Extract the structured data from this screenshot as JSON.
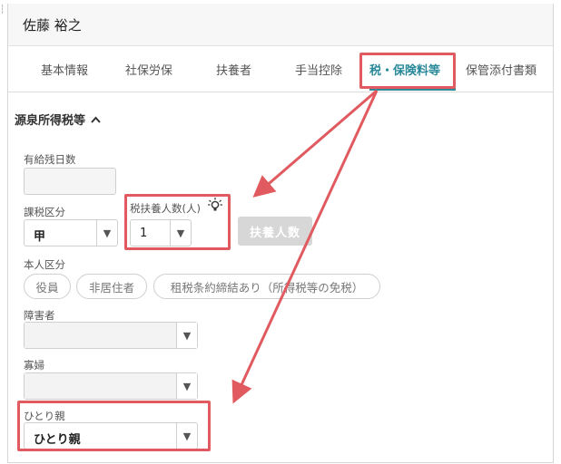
{
  "header": {
    "employee_name": "佐藤 裕之"
  },
  "tabs": [
    {
      "label": "基本情報",
      "active": false
    },
    {
      "label": "社保労保",
      "active": false
    },
    {
      "label": "扶養者",
      "active": false
    },
    {
      "label": "手当控除",
      "active": false
    },
    {
      "label": "税・保険料等",
      "active": true
    },
    {
      "label": "保管添付書類",
      "active": false
    }
  ],
  "section": {
    "title": "源泉所得税等",
    "chevron_icon": "chevron-up-icon"
  },
  "form": {
    "paid_leave": {
      "label": "有給残日数",
      "value": ""
    },
    "tax_category": {
      "label": "課税区分",
      "value": "甲"
    },
    "dependents": {
      "label": "税扶養人数(人)",
      "value": "1",
      "hint_icon": "lightbulb-icon"
    },
    "dependents_button": {
      "label": "扶養人数",
      "enabled": false
    },
    "personal_category": {
      "label": "本人区分",
      "options": [
        "役員",
        "非居住者",
        "租税条約締結あり（所得税等の免税）"
      ]
    },
    "disability": {
      "label": "障害者",
      "value": ""
    },
    "widow": {
      "label": "寡婦",
      "value": ""
    },
    "single_parent": {
      "label": "ひとり親",
      "value": "ひとり親"
    }
  },
  "colors": {
    "accent": "#2a8a9a",
    "highlight": "#e05a5f",
    "disabled_button": "#d7d7d7"
  }
}
